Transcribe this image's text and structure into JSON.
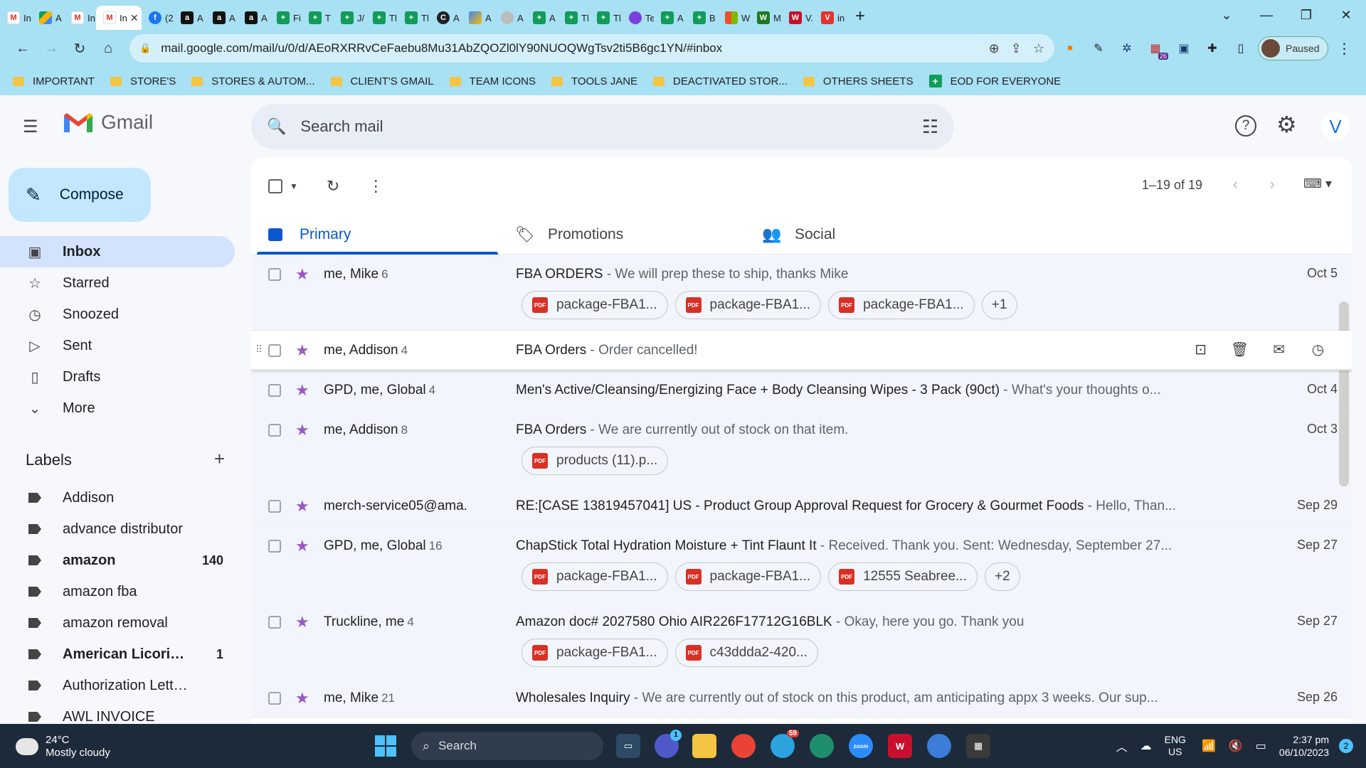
{
  "browser": {
    "tabs": [
      {
        "icon": "gmail-icon",
        "label": "In"
      },
      {
        "icon": "drive-icon",
        "label": "A"
      },
      {
        "icon": "gmail-icon",
        "label": "In"
      },
      {
        "icon": "gmail-icon",
        "label": "In",
        "active": true
      },
      {
        "icon": "facebook-icon",
        "label": "(2"
      },
      {
        "icon": "amazon-icon",
        "label": "A"
      },
      {
        "icon": "amazon-icon",
        "label": "A"
      },
      {
        "icon": "amazon-icon",
        "label": "A"
      },
      {
        "icon": "sheets-icon",
        "label": "Fi"
      },
      {
        "icon": "sheets-icon",
        "label": "T"
      },
      {
        "icon": "sheets-icon",
        "label": "J/"
      },
      {
        "icon": "sheets-icon",
        "label": "Tl"
      },
      {
        "icon": "sheets-icon",
        "label": "Tl"
      },
      {
        "icon": "circle-c-icon",
        "label": "A"
      },
      {
        "icon": "pen-icon",
        "label": "A"
      },
      {
        "icon": "globe-icon",
        "label": "A"
      },
      {
        "icon": "sheets-icon",
        "label": "A"
      },
      {
        "icon": "sheets-icon",
        "label": "Tl"
      },
      {
        "icon": "sheets-icon",
        "label": "Tl"
      },
      {
        "icon": "chat-icon",
        "label": "Te"
      },
      {
        "icon": "sheets-icon",
        "label": "A"
      },
      {
        "icon": "sheets-icon",
        "label": "B"
      },
      {
        "icon": "windows-icon",
        "label": "W"
      },
      {
        "icon": "wt-icon",
        "label": "M"
      },
      {
        "icon": "w-icon",
        "label": "V."
      },
      {
        "icon": "vivaldi-icon",
        "label": "in"
      }
    ],
    "active_tab_close": "✕",
    "url": "mail.google.com/mail/u/0/d/AEoRXRRvCeFaebu8Mu31AbZQOZl0lY90NUOQWgTsv2ti5B6gc1YN/#inbox",
    "profile_status": "Paused",
    "extension_badge": "26",
    "bookmarks": [
      "IMPORTANT",
      "STORE'S",
      "STORES & AUTOM...",
      "CLIENT'S GMAIL",
      "TEAM ICONS",
      "TOOLS JANE",
      "DEACTIVATED STOR...",
      "OTHERS SHEETS",
      "EOD FOR EVERYONE"
    ]
  },
  "gmail": {
    "brand": "Gmail",
    "search_placeholder": "Search mail",
    "account_initial": "V",
    "compose_label": "Compose",
    "nav": [
      {
        "label": "Inbox",
        "icon": "inbox-icon",
        "active": true
      },
      {
        "label": "Starred",
        "icon": "star-icon"
      },
      {
        "label": "Snoozed",
        "icon": "clock-icon"
      },
      {
        "label": "Sent",
        "icon": "send-icon"
      },
      {
        "label": "Drafts",
        "icon": "draft-icon"
      },
      {
        "label": "More",
        "icon": "chevron-down-icon"
      }
    ],
    "labels_title": "Labels",
    "labels": [
      {
        "name": "Addison",
        "count": "",
        "bold": false
      },
      {
        "name": "advance distributor",
        "count": "",
        "bold": false
      },
      {
        "name": "amazon",
        "count": "140",
        "bold": true
      },
      {
        "name": "amazon fba",
        "count": "",
        "bold": false
      },
      {
        "name": "amazon removal",
        "count": "",
        "bold": false
      },
      {
        "name": "American Licorice...",
        "count": "1",
        "bold": true
      },
      {
        "name": "Authorization Letters",
        "count": "",
        "bold": false
      },
      {
        "name": "AWL INVOICE",
        "count": "",
        "bold": false
      }
    ],
    "pager": "1–19 of 19",
    "category_tabs": [
      {
        "label": "Primary",
        "icon": "inbox-icon",
        "active": true
      },
      {
        "label": "Promotions",
        "icon": "tag-icon"
      },
      {
        "label": "Social",
        "icon": "people-icon"
      }
    ],
    "threads": [
      {
        "senders": "me, Mike",
        "count": "6",
        "subject": "FBA ORDERS",
        "snippet": " - We will prep these to ship, thanks Mike",
        "date": "Oct 5",
        "attachments": [
          "package-FBA1...",
          "package-FBA1...",
          "package-FBA1..."
        ],
        "more": "+1"
      },
      {
        "senders": "me, Addison",
        "count": "4",
        "subject": "FBA Orders",
        "snippet": " - Order cancelled!",
        "date": "",
        "hover": true,
        "attachments": [],
        "more": ""
      },
      {
        "senders": "GPD, me, Global",
        "count": "4",
        "subject": "Men's Active/Cleansing/Energizing Face + Body Cleansing Wipes - 3 Pack (90ct)",
        "snippet": " - What's your thoughts o...",
        "date": "Oct 4",
        "attachments": [],
        "more": ""
      },
      {
        "senders": "me, Addison",
        "count": "8",
        "subject": "FBA Orders",
        "snippet": " - We are currently out of stock on that item.",
        "date": "Oct 3",
        "attachments": [
          "products (11).p..."
        ],
        "more": ""
      },
      {
        "senders": "merch-service05@ama.",
        "count": "",
        "subject": "RE:[CASE 13819457041] US - Product Group Approval Request for Grocery & Gourmet Foods",
        "snippet": " - Hello, Than...",
        "date": "Sep 29",
        "attachments": [],
        "more": ""
      },
      {
        "senders": "GPD, me, Global",
        "count": "16",
        "subject": "ChapStick Total Hydration Moisture + Tint Flaunt It",
        "snippet": " - Received. Thank you. Sent: Wednesday, September 27...",
        "date": "Sep 27",
        "attachments": [
          "package-FBA1...",
          "package-FBA1...",
          "12555 Seabree..."
        ],
        "more": "+2"
      },
      {
        "senders": "Truckline, me",
        "count": "4",
        "subject": "Amazon doc# 2027580 Ohio AIR226F17712G16BLK",
        "snippet": " - Okay, here you go. Thank you",
        "date": "Sep 27",
        "attachments": [
          "package-FBA1...",
          "c43ddda2-420..."
        ],
        "more": ""
      },
      {
        "senders": "me, Mike",
        "count": "21",
        "subject": "Wholesales Inquiry",
        "snippet": " - We are currently out of stock on this product, am anticipating appx 3 weeks. Our sup...",
        "date": "Sep 26",
        "attachments": [],
        "more": ""
      }
    ]
  },
  "taskbar": {
    "temp": "24°C",
    "weather": "Mostly cloudy",
    "search_label": "Search",
    "lang_top": "ENG",
    "lang_bottom": "US",
    "time": "2:37 pm",
    "date": "06/10/2023",
    "notifications": "2",
    "telegram_badge": "59",
    "teams_badge": "1"
  }
}
